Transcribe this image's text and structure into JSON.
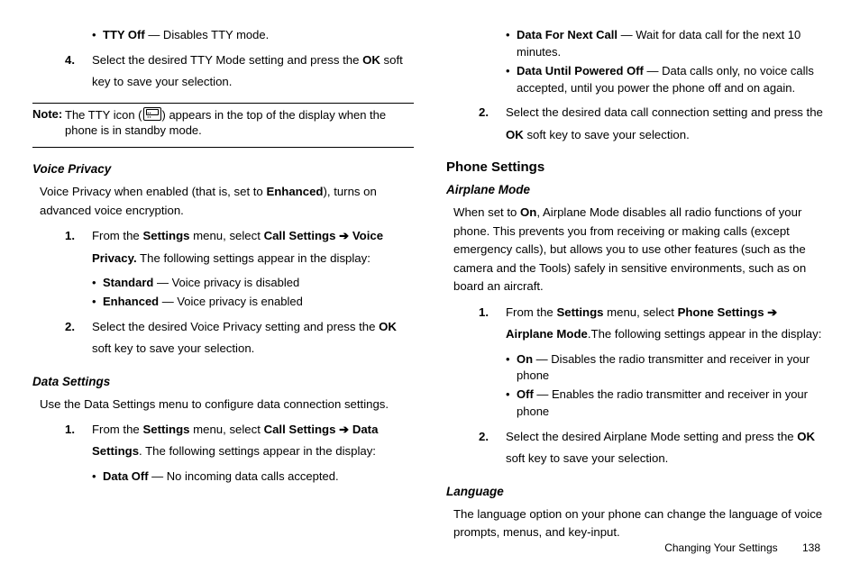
{
  "left": {
    "tty_off_label": "TTY Off",
    "tty_off_desc": " — Disables TTY mode.",
    "step4_num": "4.",
    "step4_a": "Select the desired TTY Mode setting and press the ",
    "step4_b": "OK",
    "step4_c": " soft key to save your selection.",
    "note_label": "Note:",
    "note_a": "The TTY icon (",
    "note_b": ") appears in the top of the display when the phone is in standby mode.",
    "vp_heading": "Voice Privacy",
    "vp_intro_a": "Voice Privacy when enabled (that is, set to ",
    "vp_intro_b": "Enhanced",
    "vp_intro_c": "), turns on advanced voice encryption.",
    "vp_s1_num": "1.",
    "vp_s1_a": "From the ",
    "vp_s1_b": "Settings",
    "vp_s1_c": " menu, select ",
    "vp_s1_d": "Call Settings",
    "vp_s1_e": " ➔ ",
    "vp_s1_f": "Voice Privacy.",
    "vp_s1_g": " The following settings appear in the display:",
    "vp_std_label": "Standard",
    "vp_std_desc": " — Voice privacy is disabled",
    "vp_enh_label": "Enhanced",
    "vp_enh_desc": " — Voice privacy is enabled",
    "vp_s2_num": "2.",
    "vp_s2_a": "Select the desired Voice Privacy setting and press the ",
    "vp_s2_b": "OK",
    "vp_s2_c": " soft key to save your selection.",
    "ds_heading": "Data Settings",
    "ds_intro": "Use the Data Settings menu to configure data connection settings.",
    "ds_s1_num": "1.",
    "ds_s1_a": "From the ",
    "ds_s1_b": "Settings",
    "ds_s1_c": " menu, select ",
    "ds_s1_d": "Call Settings",
    "ds_s1_e": " ➔ ",
    "ds_s1_f": "Data Settings",
    "ds_s1_g": ". The following settings appear in the display:",
    "ds_off_label": "Data Off",
    "ds_off_desc": " — No incoming data calls accepted."
  },
  "right": {
    "dnext_label": "Data For Next Call",
    "dnext_desc": " — Wait for data call for the next 10 minutes.",
    "dpow_label": "Data Until Powered Off",
    "dpow_desc": " — Data calls only, no voice calls accepted, until you power the phone off and on again.",
    "ds_s2_num": "2.",
    "ds_s2_a": "Select the desired data call connection setting and press the ",
    "ds_s2_b": "OK",
    "ds_s2_c": " soft key to save your selection.",
    "ps_heading": "Phone Settings",
    "am_heading": "Airplane Mode",
    "am_intro_a": "When set to ",
    "am_intro_b": "On",
    "am_intro_c": ", Airplane Mode disables all radio functions of your phone. This prevents you from receiving or making calls (except emergency calls), but allows you to use other features (such as the camera and the Tools) safely in sensitive environments, such as on board an aircraft.",
    "am_s1_num": "1.",
    "am_s1_a": "From the ",
    "am_s1_b": "Settings",
    "am_s1_c": " menu, select ",
    "am_s1_d": "Phone Settings",
    "am_s1_e": " ➔ ",
    "am_s1_f": "Airplane Mode",
    "am_s1_g": ".The following settings appear in the display:",
    "am_on_label": "On",
    "am_on_desc": " — Disables the radio transmitter and receiver in your phone",
    "am_off_label": "Off",
    "am_off_desc": " — Enables the radio transmitter and receiver in your phone",
    "am_s2_num": "2.",
    "am_s2_a": "Select the desired Airplane Mode setting and press the ",
    "am_s2_b": "OK",
    "am_s2_c": " soft key to save your selection.",
    "lang_heading": "Language",
    "lang_intro": "The language option on your phone can change the language of voice prompts, menus, and key-input."
  },
  "footer": {
    "section": "Changing Your Settings",
    "page": "138"
  }
}
